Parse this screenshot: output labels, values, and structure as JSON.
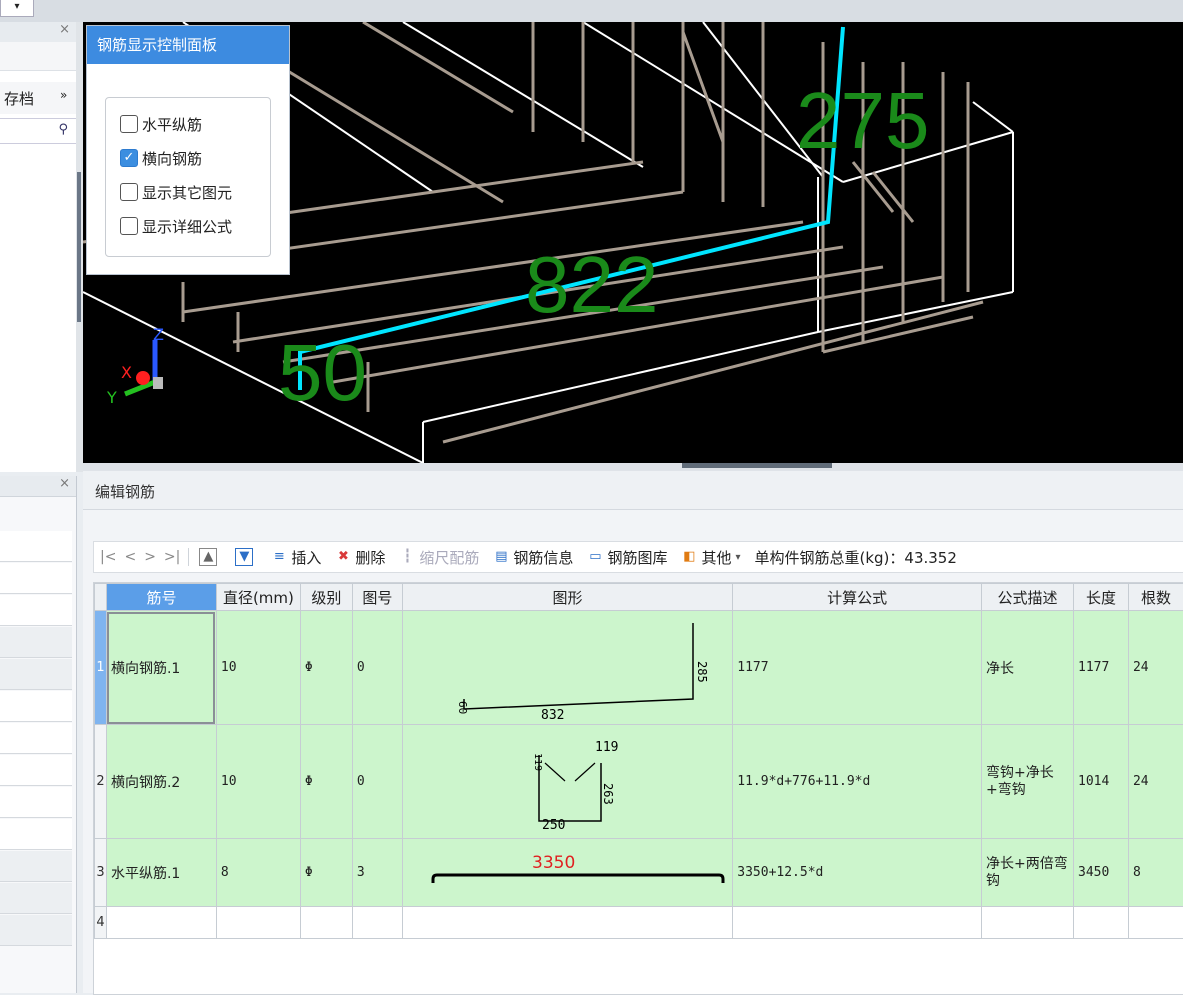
{
  "viewport": {
    "dims": [
      "275",
      "822",
      "50"
    ],
    "axes": {
      "x": "X",
      "y": "Y",
      "z": "Z"
    }
  },
  "control_panel": {
    "title": "钢筋显示控制面板",
    "options": [
      {
        "label": "水平纵筋",
        "checked": false
      },
      {
        "label": "横向钢筋",
        "checked": true
      },
      {
        "label": "显示其它图元",
        "checked": false
      },
      {
        "label": "显示详细公式",
        "checked": false
      }
    ]
  },
  "left_panel": {
    "archive_label": "存档",
    "more_icon": "double-chevron-right-icon",
    "search_icon": "search-icon",
    "close_label": "×"
  },
  "editor": {
    "title": "编辑钢筋",
    "nav": [
      "|<",
      "<",
      ">",
      ">|"
    ],
    "toolbar": {
      "insert": "插入",
      "delete": "删除",
      "scale": "缩尺配筋",
      "info": "钢筋信息",
      "library": "钢筋图库",
      "other": "其他",
      "total_label": "单构件钢筋总重(kg)：43.352"
    },
    "columns": [
      "筋号",
      "直径(mm)",
      "级别",
      "图号",
      "图形",
      "计算公式",
      "公式描述",
      "长度",
      "根数"
    ],
    "rows": [
      {
        "num": "1",
        "name": "横向钢筋.1",
        "dia": "10",
        "grade": "Φ",
        "fig": "0",
        "formula": "1177",
        "desc": "净长",
        "length": "1177",
        "count": "24",
        "shape_labels": {
          "a": "285",
          "b": "832",
          "c": "60"
        }
      },
      {
        "num": "2",
        "name": "横向钢筋.2",
        "dia": "10",
        "grade": "Φ",
        "fig": "0",
        "formula": "11.9*d+776+11.9*d",
        "desc": "弯钩+净长+弯钩",
        "length": "1014",
        "count": "24",
        "shape_labels": {
          "a": "119",
          "b": "263",
          "c": "250",
          "d": "119"
        }
      },
      {
        "num": "3",
        "name": "水平纵筋.1",
        "dia": "8",
        "grade": "Φ",
        "fig": "3",
        "formula": "3350+12.5*d",
        "desc": "净长+两倍弯钩",
        "length": "3450",
        "count": "8",
        "shape_labels": {
          "a": "3350"
        }
      },
      {
        "num": "4",
        "name": "",
        "dia": "",
        "grade": "",
        "fig": "",
        "formula": "",
        "desc": "",
        "length": "",
        "count": ""
      }
    ]
  },
  "colors": {
    "accent": "#3d8be0",
    "row_green": "#ccf5cc",
    "dim_green": "#1a8a1a",
    "rebar_highlight": "#00e5ff",
    "rebar": "#a89c90",
    "dim_red": "#e02020"
  }
}
